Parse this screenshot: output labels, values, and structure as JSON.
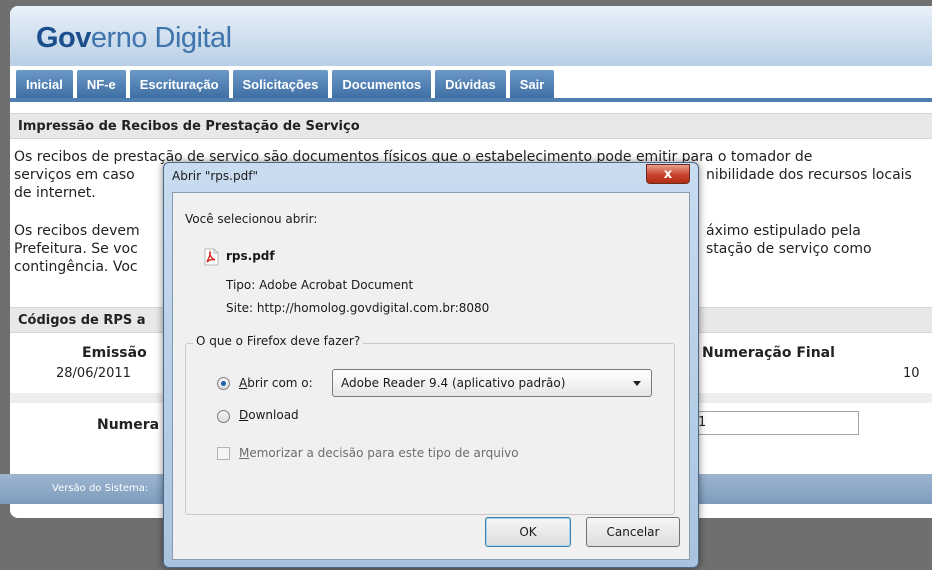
{
  "site": {
    "brand_bold": "Gov",
    "brand_rest": "erno Digital",
    "tabs": [
      {
        "label": "Inicial"
      },
      {
        "label": "NF-e"
      },
      {
        "label": "Escrituração"
      },
      {
        "label": "Solicitações"
      },
      {
        "label": "Documentos"
      },
      {
        "label": "Dúvidas"
      },
      {
        "label": "Sair"
      }
    ],
    "section_title": "Impressão de Recibos de Prestação de Serviço",
    "para1_line1": "Os recibos de prestação de serviço são documentos físicos que o estabelecimento pode emitir para o tomador de",
    "para1_line2_left": "serviços em caso",
    "para1_line2_right": "nibilidade dos recursos locais",
    "para1_line3": "de internet.",
    "para2_line1_left": "Os recibos devem",
    "para2_line1_right": "áximo estipulado pela",
    "para2_line2_left": "Prefeitura. Se voc",
    "para2_line2_right": "stação de serviço como",
    "para2_line3_left": "contingência. Voc",
    "rps_section": "Códigos de RPS a",
    "emissao_label": "Emissão",
    "emissao_value": "28/06/2011",
    "numeracao_final_label": "Numeração Final",
    "numeracao_final_value": "10",
    "numera_label": "Numera",
    "numeracao_input_value": "1",
    "footer_text": "Versão do Sistema:"
  },
  "dialog": {
    "title": "Abrir \"rps.pdf\"",
    "close_label": "x",
    "intro": "Você selecionou abrir:",
    "file_name": "rps.pdf",
    "tipo_label": "Tipo:",
    "tipo_value": "Adobe Acrobat Document",
    "site_label": "Site:",
    "site_value": "http://homolog.govdigital.com.br:8080",
    "group_title": "O que o Firefox deve fazer?",
    "option_open_prefix": "A",
    "option_open_rest": "brir com o:",
    "open_with_app": "Adobe Reader 9.4 (aplicativo padrão)",
    "option_download_prefix": "D",
    "option_download_rest": "ownload",
    "remember_prefix": "M",
    "remember_rest": "emorizar a decisão para este tipo de arquivo",
    "ok_label": "OK",
    "cancel_label": "Cancelar",
    "selected_option": "open_with",
    "remember_checked": false
  },
  "colors": {
    "tab_blue": "#4f7eb0",
    "brand_dark": "#1c4f8c",
    "close_red": "#c7422b"
  },
  "icons": [
    "pdf-icon",
    "close-icon",
    "chevron-down-icon"
  ]
}
